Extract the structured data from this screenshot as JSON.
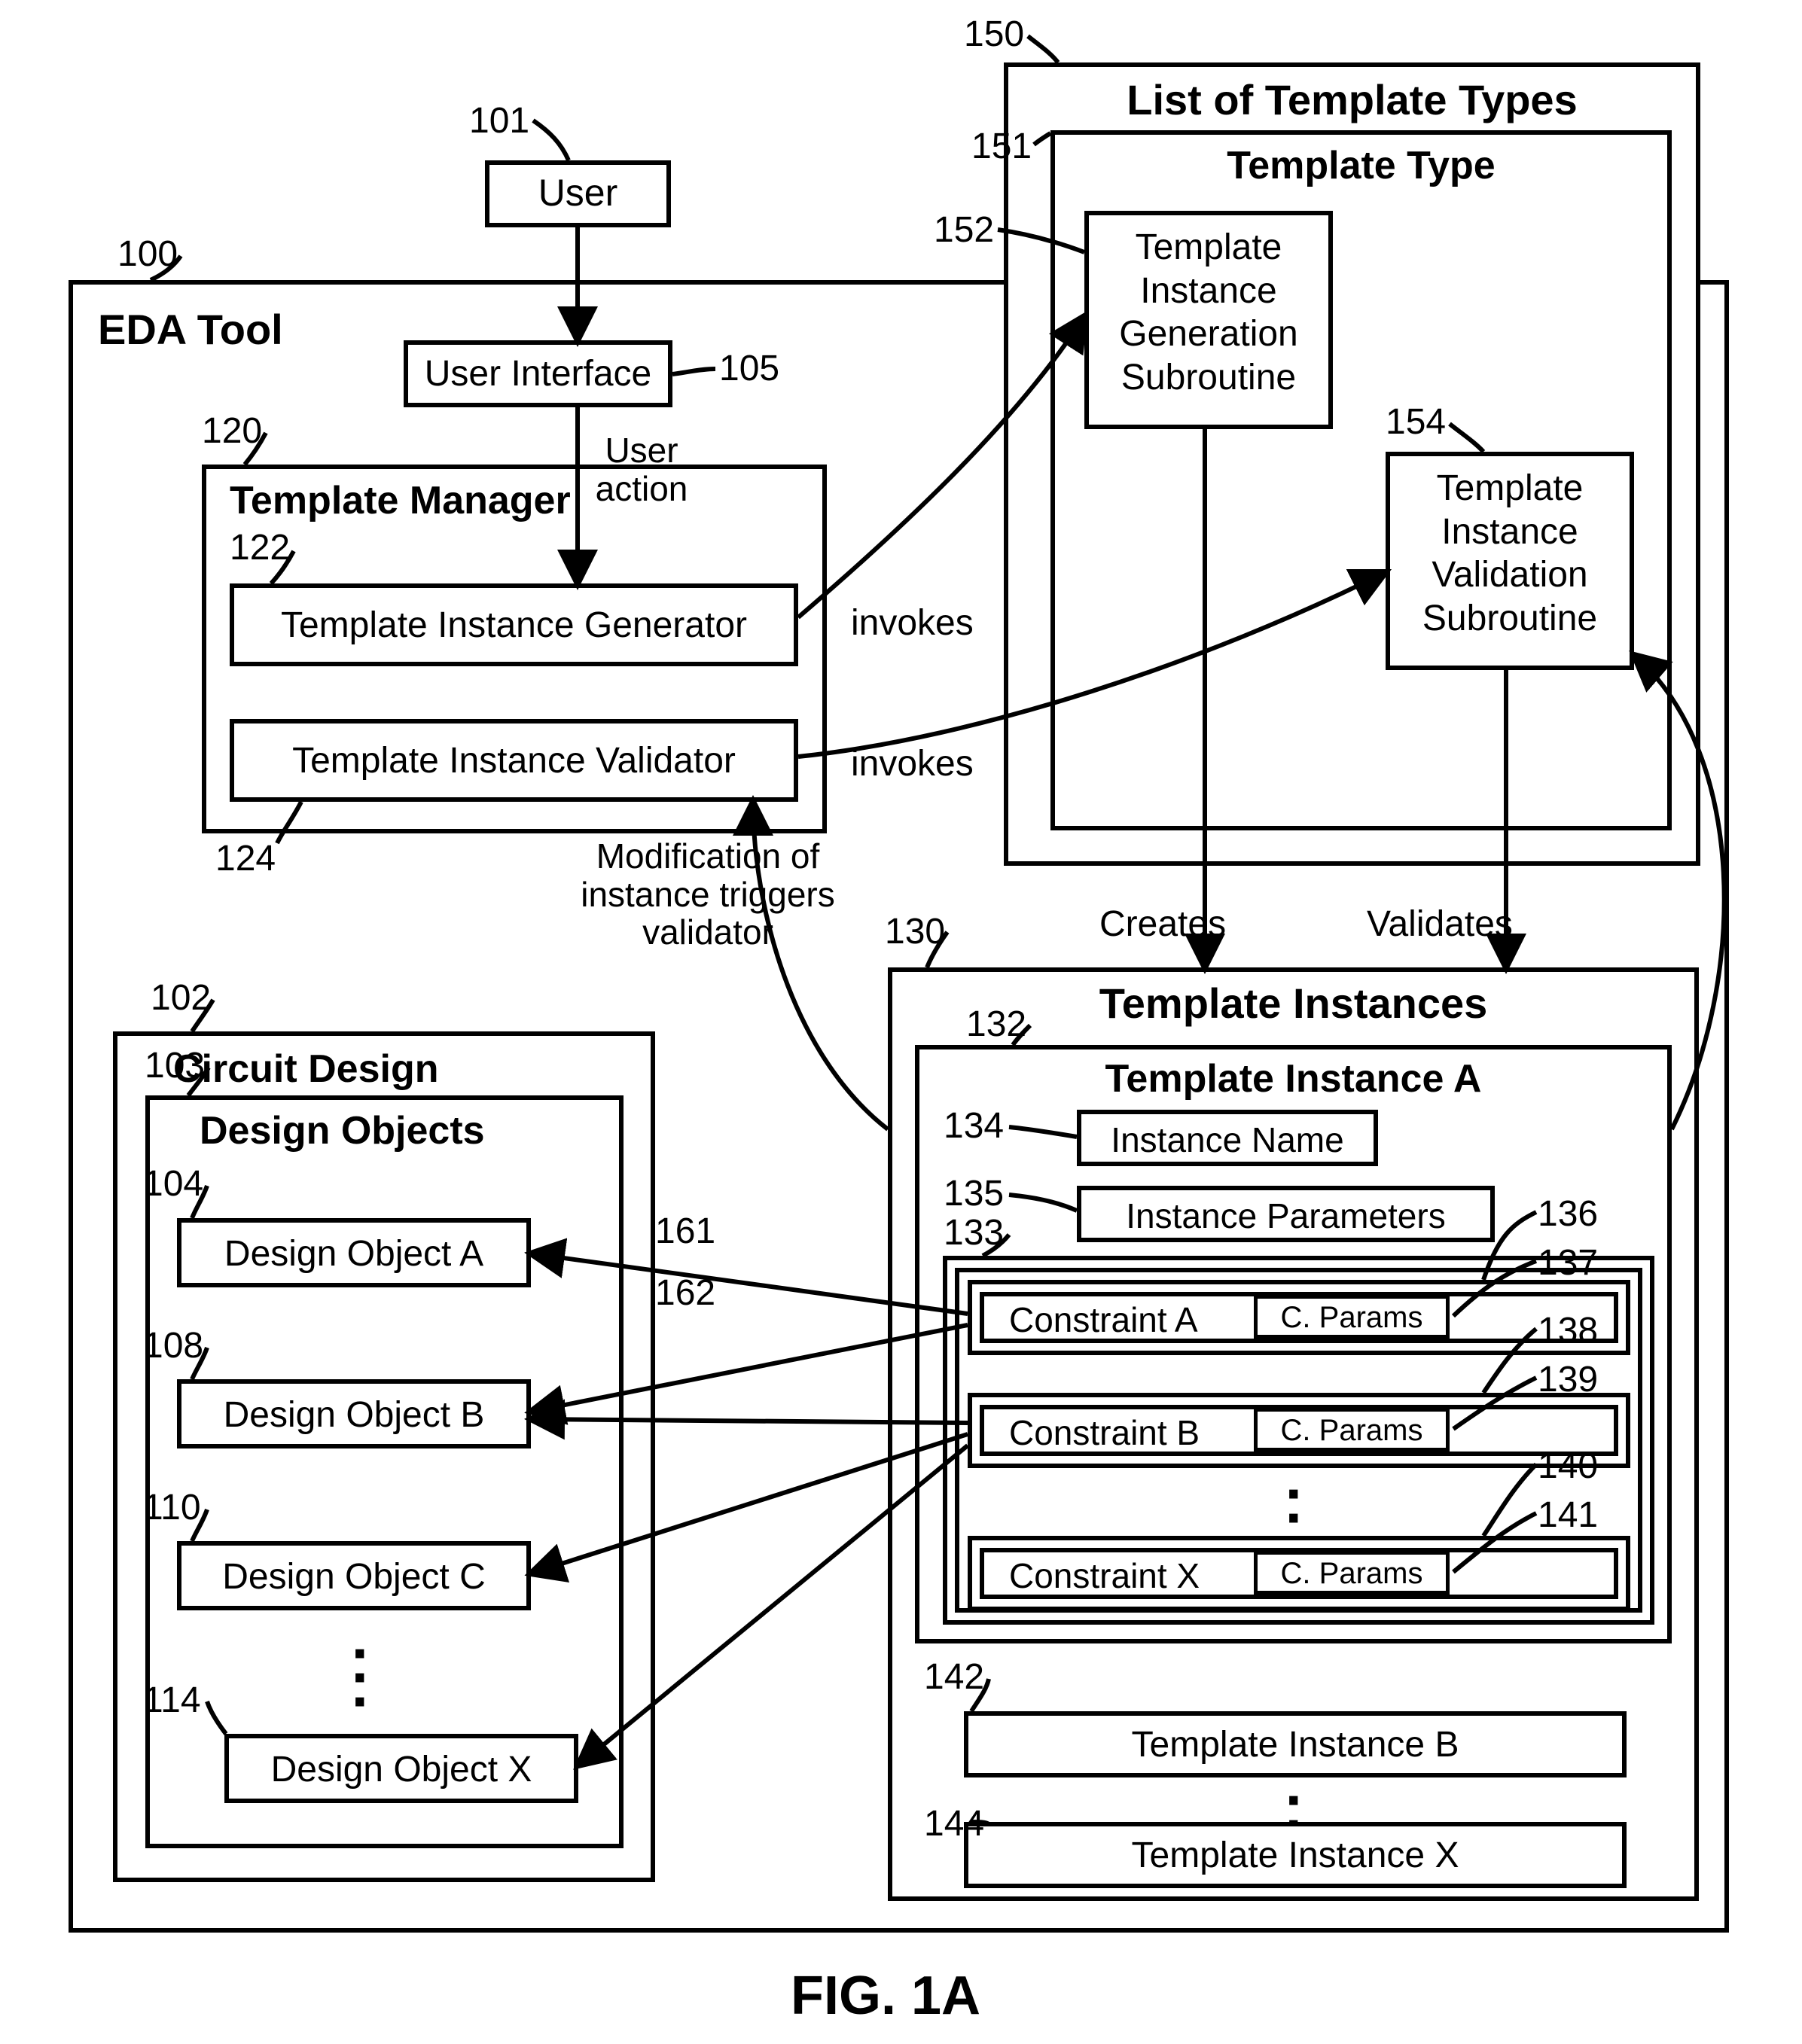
{
  "figure": "FIG. 1A",
  "refs": {
    "r100": "100",
    "r101": "101",
    "r102": "102",
    "r103": "103",
    "r104": "104",
    "r105": "105",
    "r108": "108",
    "r110": "110",
    "r114": "114",
    "r120": "120",
    "r122": "122",
    "r124": "124",
    "r130": "130",
    "r132": "132",
    "r133": "133",
    "r134": "134",
    "r135": "135",
    "r136": "136",
    "r137": "137",
    "r138": "138",
    "r139": "139",
    "r140": "140",
    "r141": "141",
    "r142": "142",
    "r144": "144",
    "r150": "150",
    "r151": "151",
    "r152": "152",
    "r154": "154",
    "r161": "161",
    "r162": "162"
  },
  "labels": {
    "user": "User",
    "user_interface": "User Interface",
    "eda_tool": "EDA Tool",
    "template_manager": "Template Manager",
    "template_instance_generator": "Template Instance Generator",
    "template_instance_validator": "Template Instance Validator",
    "circuit_design": "Circuit Design",
    "design_objects": "Design Objects",
    "design_object_a": "Design Object A",
    "design_object_b": "Design Object B",
    "design_object_c": "Design Object C",
    "design_object_x": "Design Object X",
    "list_template_types": "List of Template Types",
    "template_type": "Template Type",
    "template_instance_gen_sub": "Template\nInstance\nGeneration\nSubroutine",
    "template_instance_val_sub": "Template\nInstance\nValidation\nSubroutine",
    "template_instances": "Template Instances",
    "template_instance_a": "Template Instance A",
    "instance_name": "Instance Name",
    "instance_parameters": "Instance Parameters",
    "constraint_a": "Constraint A",
    "constraint_b": "Constraint B",
    "constraint_x": "Constraint X",
    "c_params": "C. Params",
    "template_instance_b": "Template Instance B",
    "template_instance_x": "Template Instance X",
    "user_action": "User\naction",
    "invokes": "invokes",
    "creates": "Creates",
    "validates": "Validates",
    "mod_trigger": "Modification of\ninstance triggers\nvalidator"
  }
}
